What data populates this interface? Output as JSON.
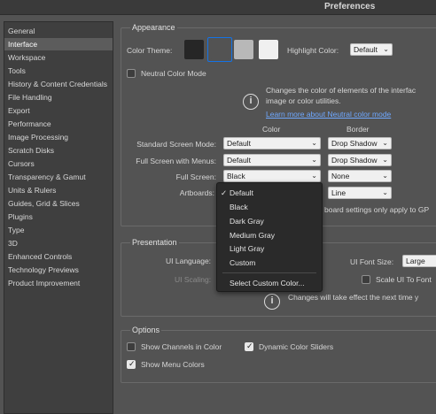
{
  "window": {
    "title": "Preferences"
  },
  "sidebar": {
    "items": [
      {
        "label": "General"
      },
      {
        "label": "Interface",
        "selected": true
      },
      {
        "label": "Workspace"
      },
      {
        "label": "Tools"
      },
      {
        "label": "History & Content Credentials"
      },
      {
        "label": "File Handling"
      },
      {
        "label": "Export"
      },
      {
        "label": "Performance"
      },
      {
        "label": "Image Processing"
      },
      {
        "label": "Scratch Disks"
      },
      {
        "label": "Cursors"
      },
      {
        "label": "Transparency & Gamut"
      },
      {
        "label": "Units & Rulers"
      },
      {
        "label": "Guides, Grid & Slices"
      },
      {
        "label": "Plugins"
      },
      {
        "label": "Type"
      },
      {
        "label": "3D"
      },
      {
        "label": "Enhanced Controls"
      },
      {
        "label": "Technology Previews"
      },
      {
        "label": "Product Improvement"
      }
    ]
  },
  "appearance": {
    "section_title": "Appearance",
    "color_theme_label": "Color Theme:",
    "theme_swatches": [
      "#262626",
      "#535353",
      "#b8b8b8",
      "#f0f0f0"
    ],
    "highlight_color_label": "Highlight Color:",
    "highlight_color_value": "Default",
    "neutral_color_mode_label": "Neutral Color Mode",
    "neutral_info_line1": "Changes the color of elements of the interfac",
    "neutral_info_line2": "image or color utilities.",
    "learn_more_link": "Learn more about Neutral color mode",
    "col_color": "Color",
    "col_border": "Border",
    "standard_screen_label": "Standard Screen Mode:",
    "standard_screen_color": "Default",
    "standard_screen_border": "Drop Shadow",
    "full_screen_menus_label": "Full Screen with Menus:",
    "full_screen_menus_color": "Default",
    "full_screen_menus_border": "Drop Shadow",
    "full_screen_label": "Full Screen:",
    "full_screen_color": "Black",
    "full_screen_border": "None",
    "artboards_label": "Artboards:",
    "artboards_border": "Line",
    "artboards_note": "board settings only apply to GP"
  },
  "color_dropdown": {
    "options": [
      "Default",
      "Black",
      "Dark Gray",
      "Medium Gray",
      "Light Gray",
      "Custom"
    ],
    "selected": "Default",
    "check_glyph": "✓",
    "custom_action": "Select Custom Color..."
  },
  "presentation": {
    "section_title": "Presentation",
    "ui_language_label": "UI Language:",
    "ui_font_size_label": "UI Font Size:",
    "ui_font_size_value": "Large",
    "ui_scaling_label": "UI Scaling:",
    "scale_ui_label": "Scale UI To Font",
    "changes_note": "Changes will take effect the next time y"
  },
  "options": {
    "section_title": "Options",
    "show_channels_label": "Show Channels in Color",
    "show_channels_checked": false,
    "dynamic_sliders_label": "Dynamic Color Sliders",
    "dynamic_sliders_checked": true,
    "show_menu_colors_label": "Show Menu Colors",
    "show_menu_colors_checked": true
  },
  "colors": {
    "accent": "#1473e6",
    "link": "#6fa8ff"
  }
}
